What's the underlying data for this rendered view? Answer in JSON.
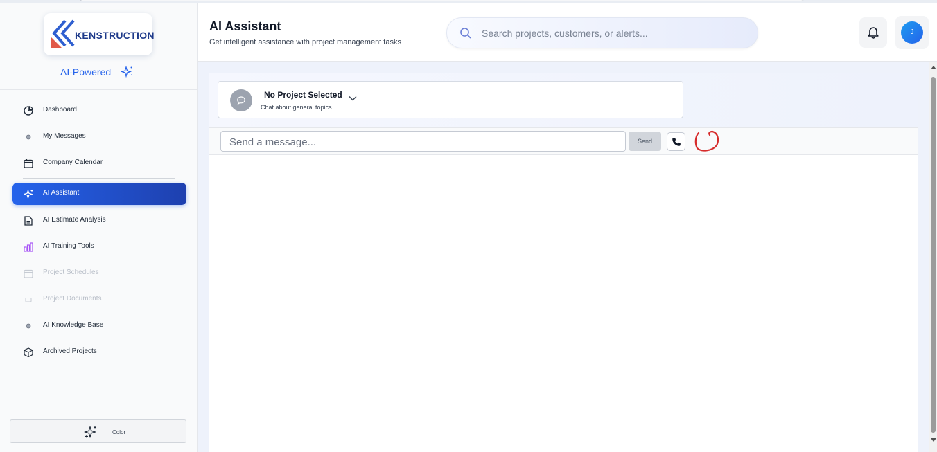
{
  "brand": {
    "logo_text": "KENSTRUCTION",
    "tagline": "AI-Powered"
  },
  "sidebar": {
    "items": [
      {
        "label": "Dashboard",
        "icon": "pie-chart-icon",
        "state": "normal"
      },
      {
        "label": "My Messages",
        "icon": "dot-icon",
        "state": "normal"
      },
      {
        "label": "Company Calendar",
        "icon": "calendar-icon",
        "state": "normal"
      },
      {
        "label": "AI Assistant",
        "icon": "sparkle-icon",
        "state": "active"
      },
      {
        "label": "AI Estimate Analysis",
        "icon": "document-icon",
        "state": "normal"
      },
      {
        "label": "AI Training Tools",
        "icon": "bar-chart-icon",
        "state": "normal"
      },
      {
        "label": "Project Schedules",
        "icon": "calendar-icon",
        "state": "disabled"
      },
      {
        "label": "Project Documents",
        "icon": "folder-icon",
        "state": "disabled"
      },
      {
        "label": "AI Knowledge Base",
        "icon": "dot-icon",
        "state": "normal"
      },
      {
        "label": "Archived Projects",
        "icon": "box-icon",
        "state": "normal"
      }
    ],
    "color_button": {
      "label": "Color",
      "icon": "sparkles-icon"
    }
  },
  "header": {
    "title": "AI Assistant",
    "subtitle": "Get intelligent assistance with project management tasks",
    "search_placeholder": "Search projects, customers, or alerts...",
    "avatar_initial": "J"
  },
  "chat": {
    "project_title": "No Project Selected",
    "project_subtitle": "Chat about general topics",
    "message_placeholder": "Send a message...",
    "send_label": "Send"
  },
  "colors": {
    "accent": "#2563eb",
    "accent_dark": "#1e40af",
    "annotation": "#d62b2b",
    "training_icon": "#a855f7"
  }
}
